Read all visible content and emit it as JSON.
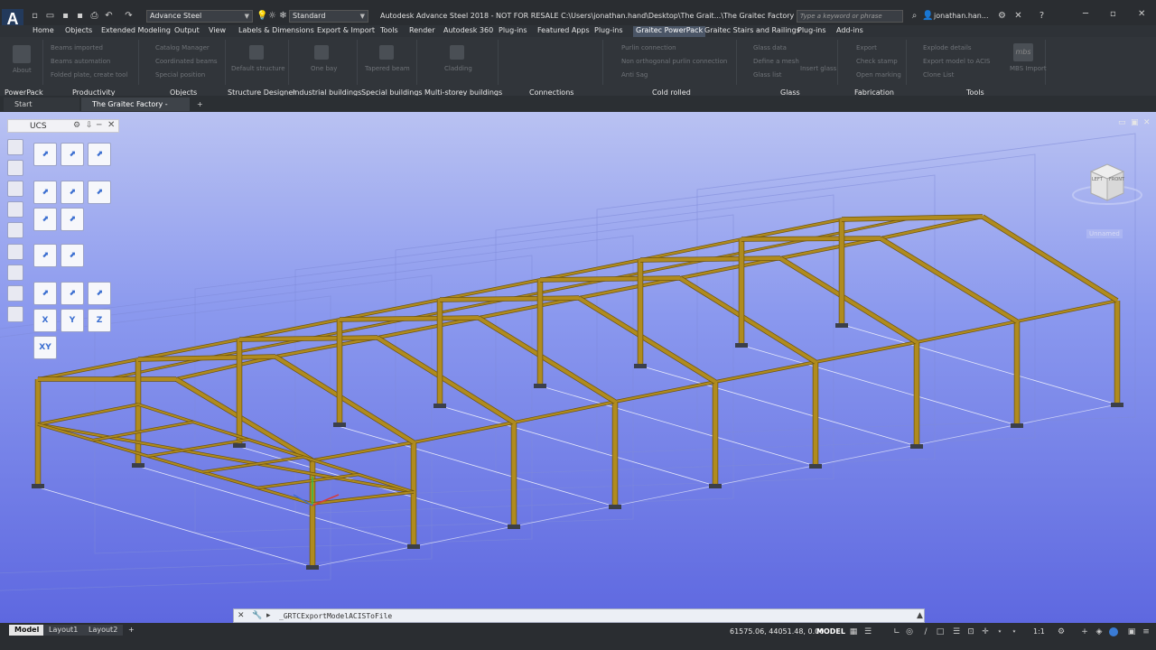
{
  "app": {
    "logo_letter": "A",
    "logo_sub": "STL",
    "workspace": "Advance Steel",
    "layer_combo": "Standard",
    "window_title": "Autodesk Advance Steel 2018 - NOT FOR RESALE   C:\\Users\\jonathan.hand\\Desktop\\The Grait...\\The Graitec Factory - AS.dwg",
    "search_placeholder": "Type a keyword or phrase",
    "user_name": "jonathan.han..."
  },
  "menu": {
    "items": [
      "Home",
      "Objects",
      "Extended Modeling",
      "Output",
      "View",
      "Labels & Dimensions",
      "Export & Import",
      "Tools",
      "Render",
      "Autodesk 360",
      "Plug-ins",
      "Featured Apps",
      "Plug-ins",
      "Graitec PowerPack",
      "Graitec Stairs and Railings",
      "Plug-ins",
      "Add-ins"
    ],
    "active_index": 13
  },
  "ribbon": {
    "panels": [
      "PowerPack",
      "Productivity",
      "Objects",
      "Structure Designer",
      "Industrial buildings",
      "Special buildings",
      "Multi-storey buildings",
      "Connections",
      "Cold rolled",
      "Glass",
      "Fabrication",
      "Tools"
    ],
    "buttons": {
      "about": "About",
      "beams_imported": "Beams imported",
      "beams_automation": "Beams automation",
      "folded_plate": "Folded plate, create tool",
      "catalog_manager": "Catalog Manager",
      "coordinated_beams": "Coordinated beams",
      "special_position": "Special position",
      "default_structure": "Default structure",
      "one_bay": "One bay",
      "tapered_beam": "Tapered beam",
      "cladding": "Cladding",
      "purlin_connection": "Purlin connection",
      "non_orthogonal": "Non orthogonal purlin connection",
      "anti_sag": "Anti Sag",
      "glass_data": "Glass data",
      "define_mesh": "Define a mesh",
      "glass_list": "Glass list",
      "insert_glass": "Insert glass",
      "export": "Export",
      "check_stamp": "Check stamp",
      "open_marking": "Open marking",
      "explode_details": "Explode details",
      "export_model": "Export model to ACIS",
      "clone_list": "Clone List",
      "mbs_import": "MBS Import",
      "mbs_logo": "mbs"
    }
  },
  "doc_tabs": {
    "start": "Start",
    "active": "The Graitec Factory - AS*",
    "add": "+"
  },
  "ucs_palette": {
    "title": "UCS",
    "buttons": [
      "ucs-origin",
      "ucs-3point",
      "ucs-world",
      "ucs-object",
      "ucs-face",
      "ucs-view",
      "ucs-zaxis",
      "ucs-previous",
      "ucs-named",
      "ucs-view-2",
      "ucs-rot-x",
      "ucs-rot-y",
      "ucs-rot-z",
      "x",
      "y",
      "z",
      "xy"
    ],
    "x_label": "X",
    "y_label": "Y",
    "z_label": "Z",
    "xy_label": "XY"
  },
  "viewcube": {
    "left": "LEFT",
    "front": "FRONT",
    "named_view": "Unnamed"
  },
  "command": {
    "text": "_GRTCExportModelACISToFile"
  },
  "status": {
    "layouts": [
      "Model",
      "Layout1",
      "Layout2"
    ],
    "add_layout": "+",
    "coords": "61575.06, 44051.48, 0.00",
    "space": "MODEL",
    "scale": "1:1"
  },
  "colors": {
    "steel": "#b08b1e",
    "steel_dark": "#6d5410",
    "viewport_top": "#b9c2f2",
    "viewport_bottom": "#5e68e0",
    "active_tab": "#4a5566"
  }
}
